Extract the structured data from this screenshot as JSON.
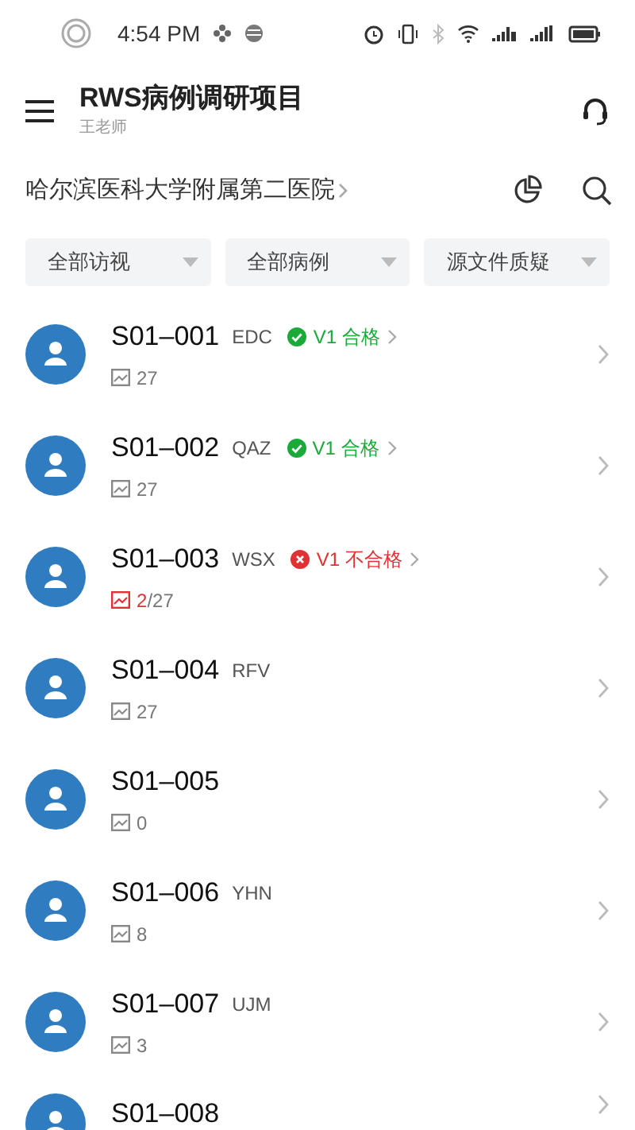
{
  "status_bar": {
    "time": "4:54 PM"
  },
  "header": {
    "title": "RWS病例调研项目",
    "subtitle": "王老师"
  },
  "site": {
    "name": "哈尔滨医科大学附属第二医院"
  },
  "filters": [
    {
      "label": "全部访视"
    },
    {
      "label": "全部病例"
    },
    {
      "label": "源文件质疑"
    }
  ],
  "patients": [
    {
      "code": "S01–001",
      "initials": "EDC",
      "status": {
        "kind": "pass",
        "text": "V1 合格"
      },
      "image_count": "27"
    },
    {
      "code": "S01–002",
      "initials": "QAZ",
      "status": {
        "kind": "pass",
        "text": "V1 合格"
      },
      "image_count": "27"
    },
    {
      "code": "S01–003",
      "initials": "WSX",
      "status": {
        "kind": "fail",
        "text": "V1 不合格"
      },
      "flagged_count": "2",
      "image_count": "/27"
    },
    {
      "code": "S01–004",
      "initials": "RFV",
      "image_count": "27"
    },
    {
      "code": "S01–005",
      "image_count": "0"
    },
    {
      "code": "S01–006",
      "initials": "YHN",
      "image_count": "8"
    },
    {
      "code": "S01–007",
      "initials": "UJM",
      "image_count": "3"
    },
    {
      "code": "S01–008"
    }
  ]
}
